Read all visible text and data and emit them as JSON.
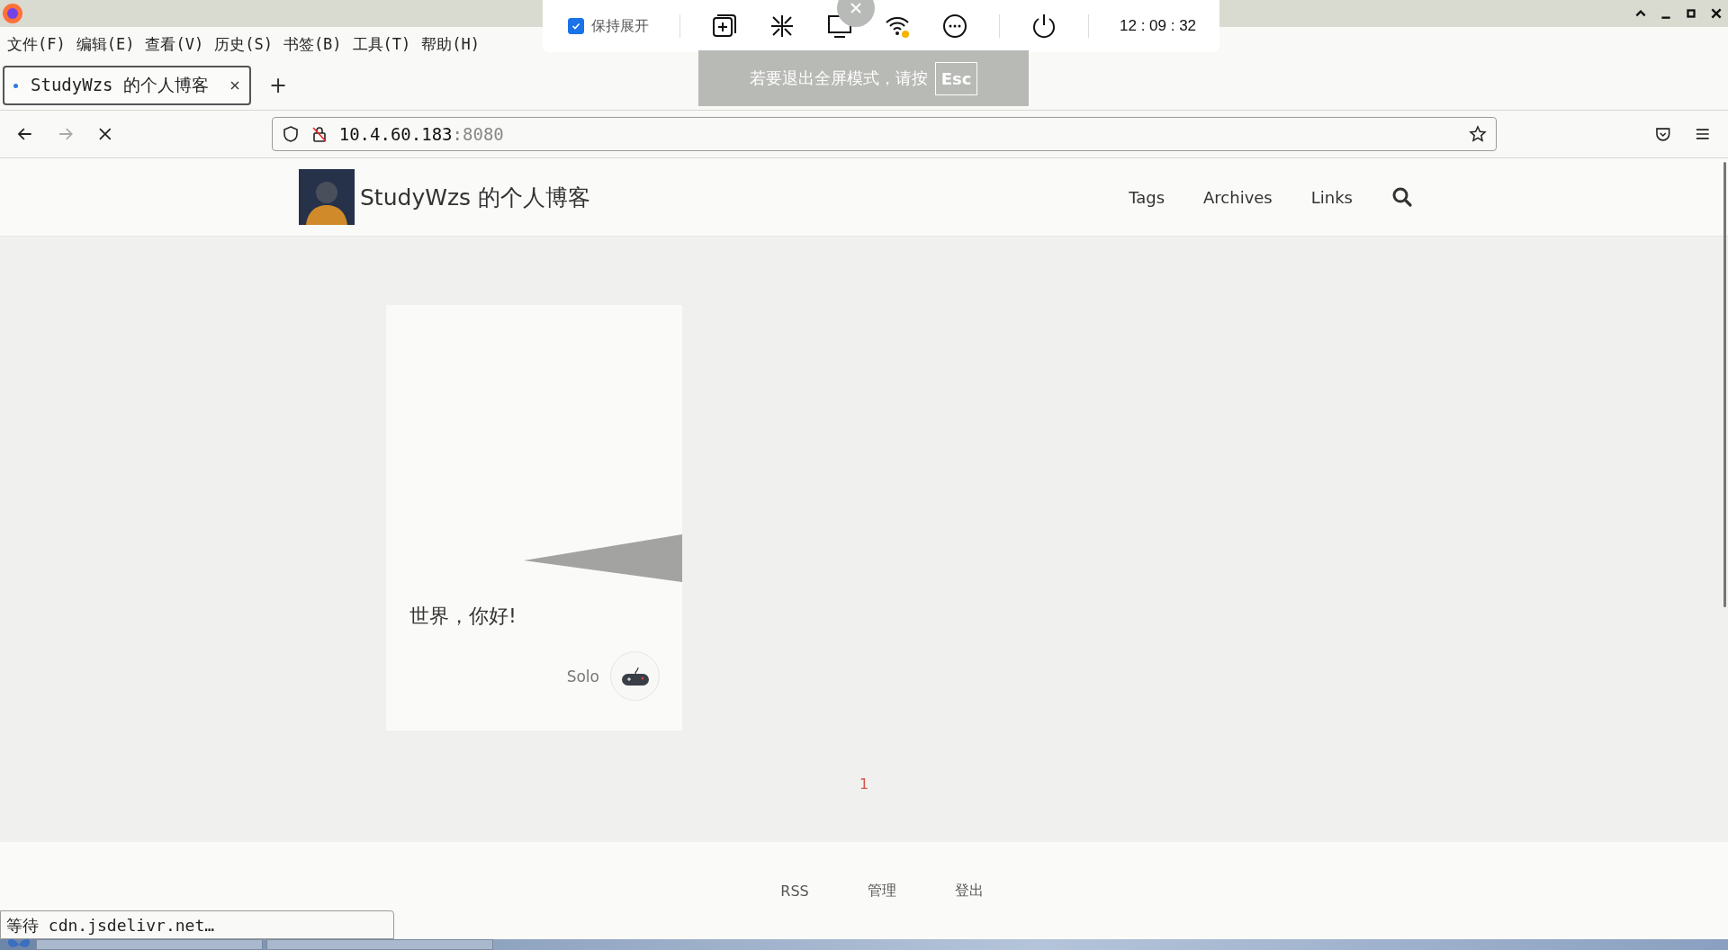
{
  "menu_bar": [
    "文件(F)",
    "编辑(E)",
    "查看(V)",
    "历史(S)",
    "书签(B)",
    "工具(T)",
    "帮助(H)"
  ],
  "tabs": [
    {
      "title": "StudyWzs 的个人博客",
      "selected": true,
      "loading": true
    }
  ],
  "new_tab": "+",
  "url": {
    "host": "10.4.60.183",
    "port": ":8080"
  },
  "remote_toolbar": {
    "keep_expanded": {
      "label": "保持展开",
      "checked": true
    },
    "time": "12 : 09 : 32"
  },
  "fullscreen_notice": {
    "text": "若要退出全屏模式，请按",
    "key": "Esc"
  },
  "blog": {
    "title": "StudyWzs 的个人博客",
    "nav": [
      "Tags",
      "Archives",
      "Links"
    ]
  },
  "post": {
    "title": "世界，你好!",
    "author": "Solo"
  },
  "pagination": [
    {
      "label": "1",
      "selected": true
    }
  ],
  "footer": [
    "RSS",
    "管理",
    "登出"
  ],
  "status": "等待 cdn.jsdelivr.net…"
}
